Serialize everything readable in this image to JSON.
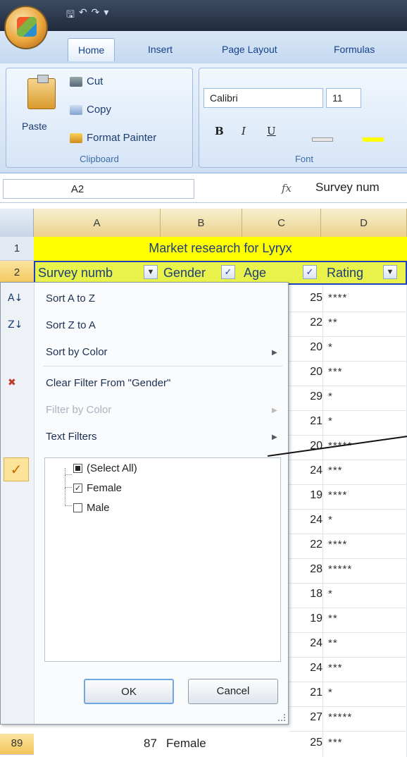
{
  "quick_access": [
    "save",
    "undo",
    "redo",
    "customize"
  ],
  "tabs": [
    "Home",
    "Insert",
    "Page Layout",
    "Formulas"
  ],
  "clipboard": {
    "paste": "Paste",
    "cut": "Cut",
    "copy": "Copy",
    "format_painter": "Format Painter",
    "label": "Clipboard"
  },
  "font": {
    "family": "Calibri",
    "size": "11",
    "label": "Font",
    "bold": "B",
    "italic": "I",
    "underline": "U"
  },
  "formula_bar": {
    "cell_ref": "A2",
    "fx": "fx",
    "value": "Survey num"
  },
  "columns": [
    "A",
    "B",
    "C",
    "D"
  ],
  "rows": {
    "r1": "1",
    "r2": "2",
    "r89": "89"
  },
  "title": "Market research for Lyryx",
  "headers": {
    "a": "Survey numb",
    "b": "Gender",
    "c": "Age",
    "d": "Rating"
  },
  "data_rows": [
    {
      "age": "25",
      "rating": "****"
    },
    {
      "age": "22",
      "rating": "**"
    },
    {
      "age": "20",
      "rating": "*"
    },
    {
      "age": "20",
      "rating": "***"
    },
    {
      "age": "29",
      "rating": "*"
    },
    {
      "age": "21",
      "rating": "*"
    },
    {
      "age": "20",
      "rating": "*****"
    },
    {
      "age": "24",
      "rating": "***"
    },
    {
      "age": "19",
      "rating": "****"
    },
    {
      "age": "24",
      "rating": "*"
    },
    {
      "age": "22",
      "rating": "****"
    },
    {
      "age": "28",
      "rating": "*****"
    },
    {
      "age": "18",
      "rating": "*"
    },
    {
      "age": "19",
      "rating": "**"
    },
    {
      "age": "24",
      "rating": "**"
    },
    {
      "age": "24",
      "rating": "***"
    },
    {
      "age": "21",
      "rating": "*"
    },
    {
      "age": "27",
      "rating": "*****"
    }
  ],
  "last_row": {
    "survey": "87",
    "gender": "Female",
    "age": "25",
    "rating": "***"
  },
  "menu": {
    "sort_az": "Sort A to Z",
    "sort_za": "Sort Z to A",
    "sort_color": "Sort by Color",
    "clear_filter": "Clear Filter From \"Gender\"",
    "filter_color": "Filter by Color",
    "text_filters": "Text Filters",
    "select_all": "(Select All)",
    "female": "Female",
    "male": "Male",
    "ok": "OK",
    "cancel": "Cancel"
  },
  "colors": {
    "title_fill": "#ffff00",
    "header_fill": "#e8f24a",
    "header_border": "#1f3fbf",
    "selected_row_header": "#f3c65a"
  }
}
